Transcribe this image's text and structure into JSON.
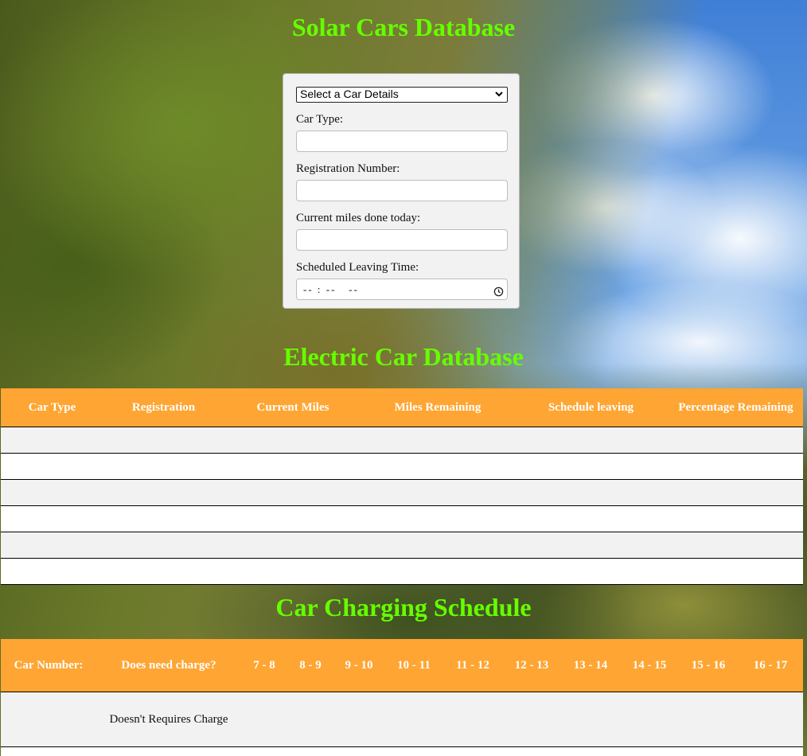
{
  "header": {
    "title": "Solar Cars Database"
  },
  "form": {
    "select": {
      "selected": "Select a Car Details"
    },
    "fields": [
      {
        "label": "Car Type:",
        "value": ""
      },
      {
        "label": "Registration Number:",
        "value": ""
      },
      {
        "label": "Current miles done today:",
        "value": ""
      },
      {
        "label": "Scheduled Leaving Time:",
        "value": "-- : --   --"
      }
    ]
  },
  "electric_db": {
    "title": "Electric Car Database",
    "columns": [
      "Car Type",
      "Registration",
      "Current Miles",
      "Miles Remaining",
      "Schedule leaving",
      "Percentage Remaining"
    ],
    "rows": [
      [
        "",
        "",
        "",
        "",
        "",
        ""
      ],
      [
        "",
        "",
        "",
        "",
        "",
        ""
      ],
      [
        "",
        "",
        "",
        "",
        "",
        ""
      ],
      [
        "",
        "",
        "",
        "",
        "",
        ""
      ],
      [
        "",
        "",
        "",
        "",
        "",
        ""
      ],
      [
        "",
        "",
        "",
        "",
        "",
        ""
      ]
    ]
  },
  "charging": {
    "title": "Car Charging Schedule",
    "columns": [
      "Car Number:",
      "Does need charge?",
      "7 - 8",
      "8 - 9",
      "9 - 10",
      "10 - 11",
      "11 - 12",
      "12 - 13",
      "13 - 14",
      "14 - 15",
      "15 - 16",
      "16 - 17"
    ],
    "rows": [
      [
        "",
        "Doesn't Requires Charge",
        "",
        "",
        "",
        "",
        "",
        "",
        "",
        "",
        "",
        ""
      ]
    ]
  },
  "colors": {
    "title_green": "#66ff00",
    "header_orange": "#ffa533"
  },
  "icons": {
    "select_arrow": "chevron-down-icon",
    "time_picker": "clock-icon"
  }
}
